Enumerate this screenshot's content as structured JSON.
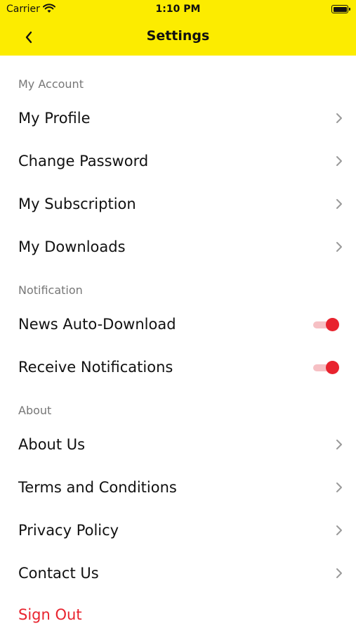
{
  "status_bar": {
    "carrier": "Carrier",
    "time": "1:10 PM"
  },
  "nav": {
    "title": "Settings"
  },
  "sections": {
    "account": {
      "label": "My Account",
      "items": [
        "My Profile",
        "Change Password",
        "My Subscription",
        "My Downloads"
      ]
    },
    "notification": {
      "label": "Notification",
      "items": [
        {
          "label": "News Auto-Download",
          "enabled": true
        },
        {
          "label": "Receive Notifications",
          "enabled": true
        }
      ]
    },
    "about": {
      "label": "About",
      "items": [
        "About Us",
        "Terms and Conditions",
        "Privacy Policy",
        "Contact Us"
      ]
    }
  },
  "sign_out": {
    "label": "Sign Out"
  },
  "colors": {
    "header_bg": "#fcec00",
    "accent": "#e8232e",
    "toggle_track": "#f6c0c4",
    "section_label": "#777777",
    "chevron": "#9a9a9a"
  }
}
